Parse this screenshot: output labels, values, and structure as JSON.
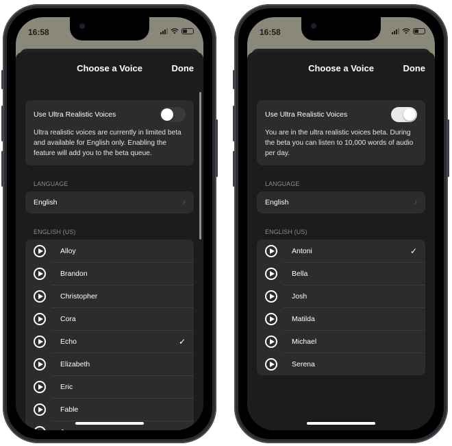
{
  "screens": [
    {
      "status": {
        "time": "16:58"
      },
      "nav": {
        "title": "Choose a Voice",
        "done": "Done"
      },
      "toggle": {
        "label": "Use Ultra Realistic Voices",
        "state": "off",
        "description": "Ultra realistic voices are currently in limited beta and available for English only. Enabling the feature will add you to the beta queue."
      },
      "language": {
        "header": "LANGUAGE",
        "value": "English"
      },
      "voices": {
        "header": "ENGLISH (US)",
        "items": [
          {
            "name": "Alloy",
            "selected": false
          },
          {
            "name": "Brandon",
            "selected": false
          },
          {
            "name": "Christopher",
            "selected": false
          },
          {
            "name": "Cora",
            "selected": false
          },
          {
            "name": "Echo",
            "selected": true
          },
          {
            "name": "Elizabeth",
            "selected": false
          },
          {
            "name": "Eric",
            "selected": false
          },
          {
            "name": "Fable",
            "selected": false
          },
          {
            "name": "Jenny",
            "selected": false
          }
        ]
      }
    },
    {
      "status": {
        "time": "16:58"
      },
      "nav": {
        "title": "Choose a Voice",
        "done": "Done"
      },
      "toggle": {
        "label": "Use Ultra Realistic Voices",
        "state": "on",
        "description": "You are in the ultra realistic voices beta. During the beta you can listen to 10,000 words of audio per day."
      },
      "language": {
        "header": "LANGUAGE",
        "value": "English"
      },
      "voices": {
        "header": "ENGLISH (US)",
        "items": [
          {
            "name": "Antoni",
            "selected": true
          },
          {
            "name": "Bella",
            "selected": false
          },
          {
            "name": "Josh",
            "selected": false
          },
          {
            "name": "Matilda",
            "selected": false
          },
          {
            "name": "Michael",
            "selected": false
          },
          {
            "name": "Serena",
            "selected": false
          }
        ]
      }
    }
  ],
  "icons": {
    "play": "play-circle-icon",
    "check": "checkmark-icon",
    "chevron": "chevron-right-icon"
  },
  "glyphs": {
    "check": "✓",
    "chevron": "›"
  },
  "colors": {
    "sheet": "#1c1c1e",
    "card": "#2c2c2e",
    "wallpaper": "#8a8878",
    "switch_on": "#e9e9ea",
    "switch_off": "#3a3a3c"
  }
}
